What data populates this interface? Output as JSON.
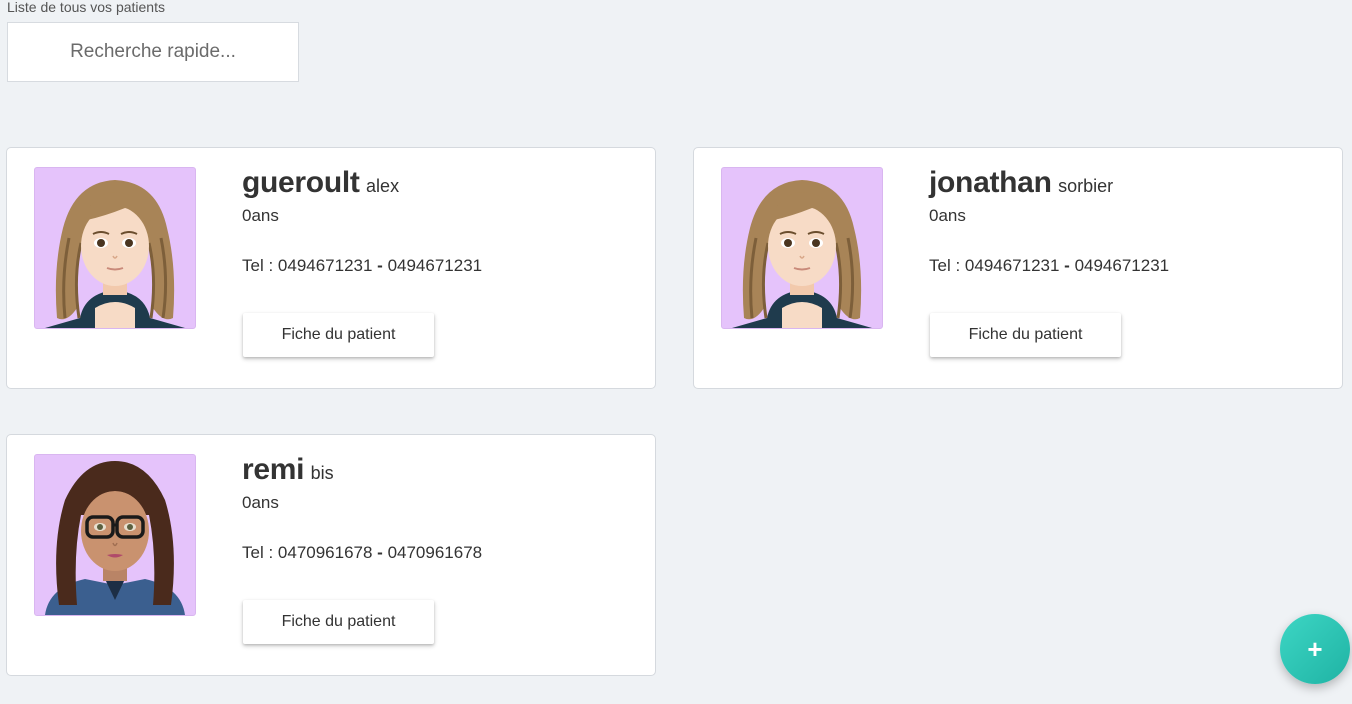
{
  "list_label": "Liste de tous vos patients",
  "search": {
    "placeholder": "Recherche rapide..."
  },
  "patients": [
    {
      "lastname": "gueroult",
      "firstname": "alex",
      "age": "0ans",
      "tel_prefix": "Tel : ",
      "phone1": "0494671231",
      "separator": " - ",
      "phone2": "0494671231",
      "button_label": "Fiche du patient",
      "avatar": "female-avatar-wavy-blonde"
    },
    {
      "lastname": "jonathan",
      "firstname": "sorbier",
      "age": "0ans",
      "tel_prefix": "Tel : ",
      "phone1": "0494671231",
      "separator": " - ",
      "phone2": "0494671231",
      "button_label": "Fiche du patient",
      "avatar": "female-avatar-wavy-blonde"
    },
    {
      "lastname": "remi",
      "firstname": "bis",
      "age": "0ans",
      "tel_prefix": "Tel : ",
      "phone1": "0470961678",
      "separator": " - ",
      "phone2": "0470961678",
      "button_label": "Fiche du patient",
      "avatar": "female-avatar-brown-hair-glasses"
    }
  ],
  "fab": {
    "label": "+",
    "icon": "plus-icon"
  },
  "colors": {
    "background": "#eff2f5",
    "avatar_bg": "#e5c3fb",
    "fab": "#2cc4b4"
  }
}
